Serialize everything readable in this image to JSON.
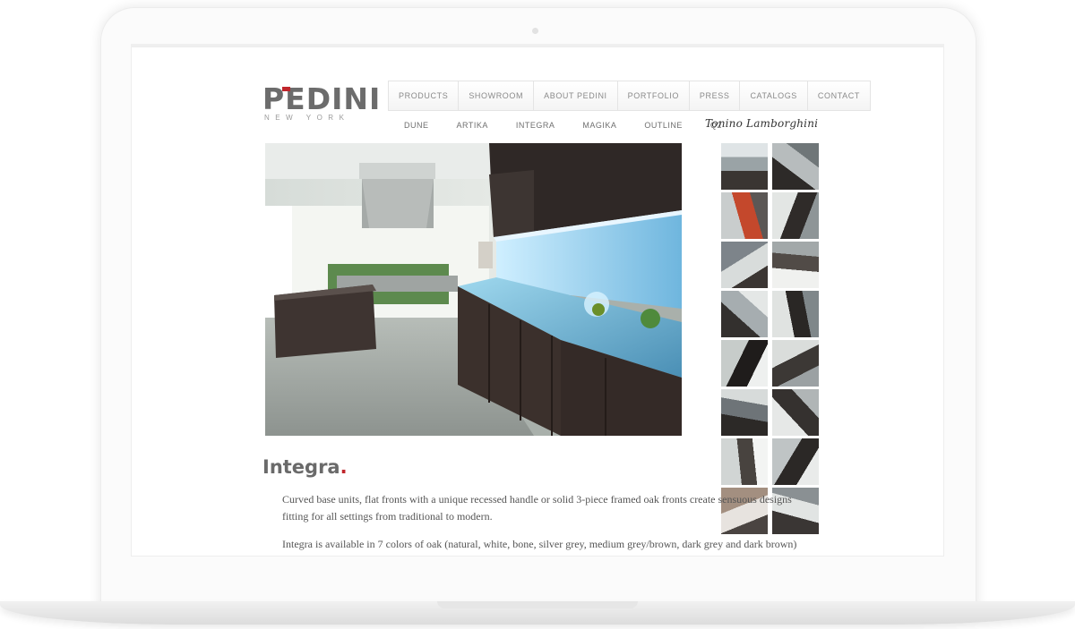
{
  "site": {
    "logo_main": "PEDINI",
    "logo_sub": "NEW YORK",
    "accent_color": "#c0262c"
  },
  "topnav": [
    "PRODUCTS",
    "SHOWROOM",
    "ABOUT PEDINI",
    "PORTFOLIO",
    "PRESS",
    "CATALOGS",
    "CONTACT"
  ],
  "subnav": [
    "DUNE",
    "ARTIKA",
    "INTEGRA",
    "MAGIKA",
    "OUTLINE",
    "Q2"
  ],
  "signature": "Tonino Lamborghini",
  "page": {
    "title": "Integra",
    "title_dot": ".",
    "paragraphs": [
      "Curved base units, flat fronts with a unique recessed handle or solid 3-piece framed oak fronts create sensuous designs fitting for all settings from traditional to modern.",
      "Integra is available in 7 colors of oak (natural, white, bone, silver grey, medium grey/brown, dark grey and dark brown)"
    ]
  },
  "images": {
    "hero": "kitchen-photo",
    "thumbnails": [
      "kitchen-thumb",
      "kitchen-thumb",
      "kitchen-thumb",
      "kitchen-thumb",
      "kitchen-thumb",
      "kitchen-thumb",
      "kitchen-thumb",
      "kitchen-thumb",
      "kitchen-thumb",
      "kitchen-thumb",
      "kitchen-thumb",
      "kitchen-thumb",
      "kitchen-thumb",
      "kitchen-thumb",
      "kitchen-thumb",
      "kitchen-thumb"
    ]
  }
}
